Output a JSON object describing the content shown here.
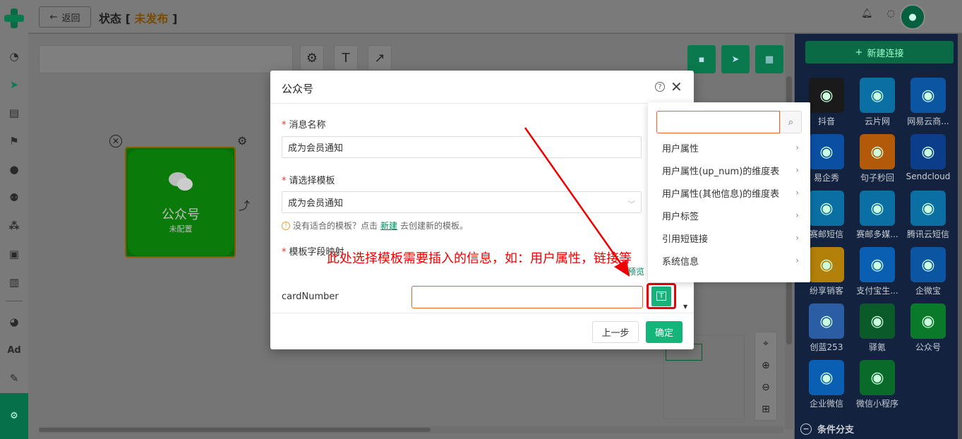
{
  "topbar": {
    "back_label": "返回",
    "status_prefix": "状态",
    "status_open": "[",
    "status_value": "未发布",
    "status_close": "]"
  },
  "node": {
    "title": "公众号",
    "subtitle": "未配置"
  },
  "right_panel": {
    "new_connection_label": "新建连接",
    "apps": [
      {
        "label": "抖音",
        "icon": "tiktok-icon",
        "color": "#1a1a1a"
      },
      {
        "label": "云片网",
        "icon": "yunpian-icon",
        "color": "#0b6fa3"
      },
      {
        "label": "网易云商...",
        "icon": "netease-icon",
        "color": "#0b55a3"
      },
      {
        "label": "易企秀",
        "icon": "eqxiu-icon",
        "color": "#0b4fa3"
      },
      {
        "label": "句子秒回",
        "icon": "jizi-icon",
        "color": "#b35a0a"
      },
      {
        "label": "Sendcloud",
        "icon": "sendcloud-icon",
        "color": "#0b3d8a"
      },
      {
        "label": "赛邮短信",
        "icon": "saiyou-sms-icon",
        "color": "#0b6fa3"
      },
      {
        "label": "赛邮多媒...",
        "icon": "saiyou-mms-icon",
        "color": "#0b6fa3"
      },
      {
        "label": "腾讯云短信",
        "icon": "tencent-cloud-icon",
        "color": "#0b6fa3"
      },
      {
        "label": "纷享销客",
        "icon": "fxiaoke-icon",
        "color": "#b3800a"
      },
      {
        "label": "支付宝生...",
        "icon": "alipay-icon",
        "color": "#0b5fb3"
      },
      {
        "label": "企微宝",
        "icon": "qiweibao-icon",
        "color": "#0b55a3"
      },
      {
        "label": "创蓝253",
        "icon": "chuanglan-icon",
        "color": "#2a5da3"
      },
      {
        "label": "驿氪",
        "icon": "yike-icon",
        "color": "#0a5a2a"
      },
      {
        "label": "公众号",
        "icon": "wechat-icon",
        "color": "#0a7a2a"
      },
      {
        "label": "企业微信",
        "icon": "wecom-icon",
        "color": "#0b5fb3"
      },
      {
        "label": "微信小程序",
        "icon": "miniprogram-icon",
        "color": "#0a6a2a"
      }
    ],
    "branch_label": "条件分支"
  },
  "modal": {
    "title": "公众号",
    "message_name_label": "消息名称",
    "message_name_value": "成为会员通知",
    "template_label": "请选择模板",
    "template_value": "成为会员通知",
    "hint_before": "没有适合的模板？点击",
    "hint_link": "新建",
    "hint_after": "去创建新的模板。",
    "mapping_label": "模板字段映射",
    "preview_label": "预览",
    "field_name": "cardNumber",
    "insert_glyph": "T",
    "prev_label": "上一步",
    "confirm_label": "确定"
  },
  "annotation": {
    "text": "此处选择模板需要插入的信息，如：用户属性，链接等",
    "color": "#e00000"
  },
  "dropdown": {
    "items": [
      "用户属性",
      "用户属性(up_num)的维度表",
      "用户属性(其他信息)的维度表",
      "用户标签",
      "引用短链接",
      "系统信息"
    ]
  },
  "colors": {
    "accent": "#13b57a",
    "required": "#ee3333",
    "link": "#0a8a5a"
  }
}
